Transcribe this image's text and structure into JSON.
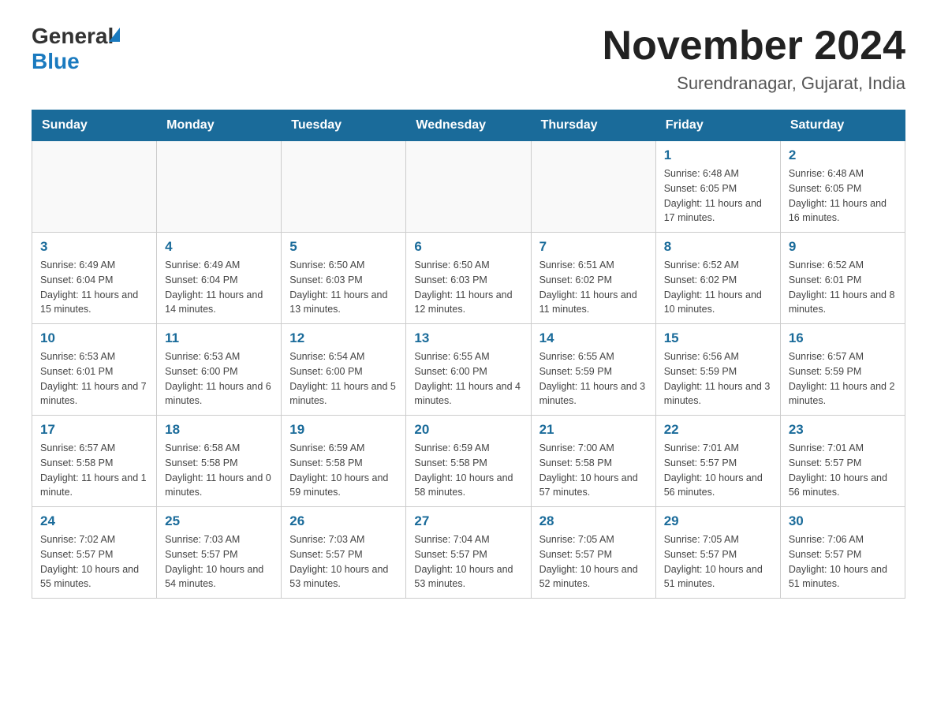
{
  "header": {
    "logo_general": "General",
    "logo_blue": "Blue",
    "month_title": "November 2024",
    "location": "Surendranagar, Gujarat, India"
  },
  "days_of_week": [
    "Sunday",
    "Monday",
    "Tuesday",
    "Wednesday",
    "Thursday",
    "Friday",
    "Saturday"
  ],
  "weeks": [
    [
      null,
      null,
      null,
      null,
      null,
      {
        "day": "1",
        "sunrise": "Sunrise: 6:48 AM",
        "sunset": "Sunset: 6:05 PM",
        "daylight": "Daylight: 11 hours and 17 minutes."
      },
      {
        "day": "2",
        "sunrise": "Sunrise: 6:48 AM",
        "sunset": "Sunset: 6:05 PM",
        "daylight": "Daylight: 11 hours and 16 minutes."
      }
    ],
    [
      {
        "day": "3",
        "sunrise": "Sunrise: 6:49 AM",
        "sunset": "Sunset: 6:04 PM",
        "daylight": "Daylight: 11 hours and 15 minutes."
      },
      {
        "day": "4",
        "sunrise": "Sunrise: 6:49 AM",
        "sunset": "Sunset: 6:04 PM",
        "daylight": "Daylight: 11 hours and 14 minutes."
      },
      {
        "day": "5",
        "sunrise": "Sunrise: 6:50 AM",
        "sunset": "Sunset: 6:03 PM",
        "daylight": "Daylight: 11 hours and 13 minutes."
      },
      {
        "day": "6",
        "sunrise": "Sunrise: 6:50 AM",
        "sunset": "Sunset: 6:03 PM",
        "daylight": "Daylight: 11 hours and 12 minutes."
      },
      {
        "day": "7",
        "sunrise": "Sunrise: 6:51 AM",
        "sunset": "Sunset: 6:02 PM",
        "daylight": "Daylight: 11 hours and 11 minutes."
      },
      {
        "day": "8",
        "sunrise": "Sunrise: 6:52 AM",
        "sunset": "Sunset: 6:02 PM",
        "daylight": "Daylight: 11 hours and 10 minutes."
      },
      {
        "day": "9",
        "sunrise": "Sunrise: 6:52 AM",
        "sunset": "Sunset: 6:01 PM",
        "daylight": "Daylight: 11 hours and 8 minutes."
      }
    ],
    [
      {
        "day": "10",
        "sunrise": "Sunrise: 6:53 AM",
        "sunset": "Sunset: 6:01 PM",
        "daylight": "Daylight: 11 hours and 7 minutes."
      },
      {
        "day": "11",
        "sunrise": "Sunrise: 6:53 AM",
        "sunset": "Sunset: 6:00 PM",
        "daylight": "Daylight: 11 hours and 6 minutes."
      },
      {
        "day": "12",
        "sunrise": "Sunrise: 6:54 AM",
        "sunset": "Sunset: 6:00 PM",
        "daylight": "Daylight: 11 hours and 5 minutes."
      },
      {
        "day": "13",
        "sunrise": "Sunrise: 6:55 AM",
        "sunset": "Sunset: 6:00 PM",
        "daylight": "Daylight: 11 hours and 4 minutes."
      },
      {
        "day": "14",
        "sunrise": "Sunrise: 6:55 AM",
        "sunset": "Sunset: 5:59 PM",
        "daylight": "Daylight: 11 hours and 3 minutes."
      },
      {
        "day": "15",
        "sunrise": "Sunrise: 6:56 AM",
        "sunset": "Sunset: 5:59 PM",
        "daylight": "Daylight: 11 hours and 3 minutes."
      },
      {
        "day": "16",
        "sunrise": "Sunrise: 6:57 AM",
        "sunset": "Sunset: 5:59 PM",
        "daylight": "Daylight: 11 hours and 2 minutes."
      }
    ],
    [
      {
        "day": "17",
        "sunrise": "Sunrise: 6:57 AM",
        "sunset": "Sunset: 5:58 PM",
        "daylight": "Daylight: 11 hours and 1 minute."
      },
      {
        "day": "18",
        "sunrise": "Sunrise: 6:58 AM",
        "sunset": "Sunset: 5:58 PM",
        "daylight": "Daylight: 11 hours and 0 minutes."
      },
      {
        "day": "19",
        "sunrise": "Sunrise: 6:59 AM",
        "sunset": "Sunset: 5:58 PM",
        "daylight": "Daylight: 10 hours and 59 minutes."
      },
      {
        "day": "20",
        "sunrise": "Sunrise: 6:59 AM",
        "sunset": "Sunset: 5:58 PM",
        "daylight": "Daylight: 10 hours and 58 minutes."
      },
      {
        "day": "21",
        "sunrise": "Sunrise: 7:00 AM",
        "sunset": "Sunset: 5:58 PM",
        "daylight": "Daylight: 10 hours and 57 minutes."
      },
      {
        "day": "22",
        "sunrise": "Sunrise: 7:01 AM",
        "sunset": "Sunset: 5:57 PM",
        "daylight": "Daylight: 10 hours and 56 minutes."
      },
      {
        "day": "23",
        "sunrise": "Sunrise: 7:01 AM",
        "sunset": "Sunset: 5:57 PM",
        "daylight": "Daylight: 10 hours and 56 minutes."
      }
    ],
    [
      {
        "day": "24",
        "sunrise": "Sunrise: 7:02 AM",
        "sunset": "Sunset: 5:57 PM",
        "daylight": "Daylight: 10 hours and 55 minutes."
      },
      {
        "day": "25",
        "sunrise": "Sunrise: 7:03 AM",
        "sunset": "Sunset: 5:57 PM",
        "daylight": "Daylight: 10 hours and 54 minutes."
      },
      {
        "day": "26",
        "sunrise": "Sunrise: 7:03 AM",
        "sunset": "Sunset: 5:57 PM",
        "daylight": "Daylight: 10 hours and 53 minutes."
      },
      {
        "day": "27",
        "sunrise": "Sunrise: 7:04 AM",
        "sunset": "Sunset: 5:57 PM",
        "daylight": "Daylight: 10 hours and 53 minutes."
      },
      {
        "day": "28",
        "sunrise": "Sunrise: 7:05 AM",
        "sunset": "Sunset: 5:57 PM",
        "daylight": "Daylight: 10 hours and 52 minutes."
      },
      {
        "day": "29",
        "sunrise": "Sunrise: 7:05 AM",
        "sunset": "Sunset: 5:57 PM",
        "daylight": "Daylight: 10 hours and 51 minutes."
      },
      {
        "day": "30",
        "sunrise": "Sunrise: 7:06 AM",
        "sunset": "Sunset: 5:57 PM",
        "daylight": "Daylight: 10 hours and 51 minutes."
      }
    ]
  ]
}
